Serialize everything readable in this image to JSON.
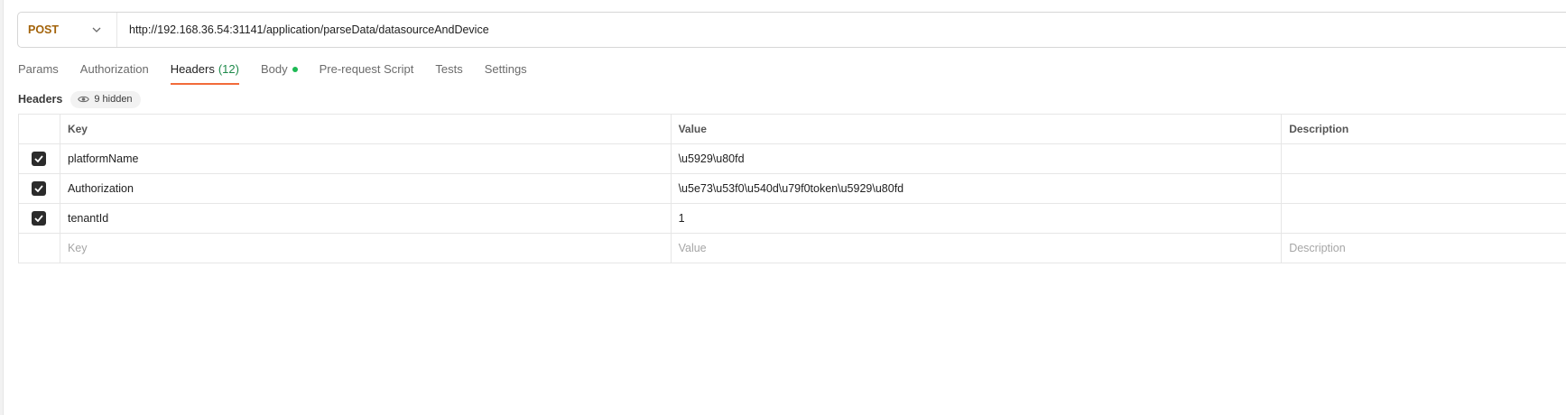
{
  "request": {
    "method": "POST",
    "url": "http://192.168.36.54:31141/application/parseData/datasourceAndDevice"
  },
  "tabs": [
    {
      "label": "Params"
    },
    {
      "label": "Authorization"
    },
    {
      "label": "Headers",
      "count": "(12)",
      "active": true
    },
    {
      "label": "Body",
      "indicator": "green-dot"
    },
    {
      "label": "Pre-request Script"
    },
    {
      "label": "Tests"
    },
    {
      "label": "Settings"
    }
  ],
  "headers_section": {
    "title": "Headers",
    "hidden_label": "9 hidden",
    "hidden_icon": "eye-icon"
  },
  "table": {
    "columns": {
      "key": "Key",
      "value": "Value",
      "description": "Description"
    },
    "rows": [
      {
        "checked": true,
        "key": "platformName",
        "value": "\\u5929\\u80fd",
        "description": ""
      },
      {
        "checked": true,
        "key": "Authorization",
        "value": "\\u5e73\\u53f0\\u540d\\u79f0token\\u5929\\u80fd",
        "description": ""
      },
      {
        "checked": true,
        "key": "tenantId",
        "value": "1",
        "description": ""
      }
    ],
    "placeholders": {
      "key": "Key",
      "value": "Value",
      "description": "Description"
    }
  },
  "colors": {
    "method": "#a3630a",
    "active_tab_underline": "#f26b3a",
    "count": "#1e8a4a",
    "body_dot": "#1db954"
  }
}
